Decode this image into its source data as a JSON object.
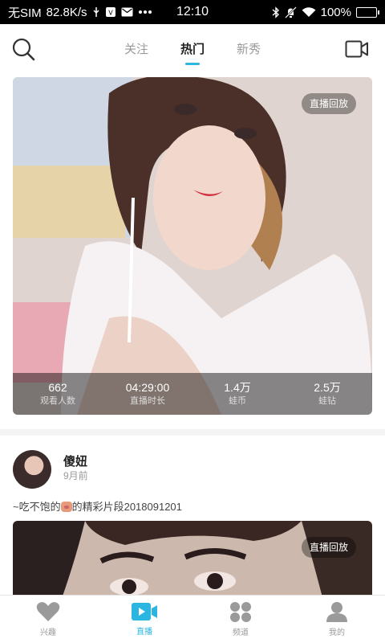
{
  "status_bar": {
    "carrier": "无SIM",
    "speed": "82.8K/s",
    "time": "12:10",
    "battery": "100%"
  },
  "top_nav": {
    "tabs": [
      "关注",
      "热门",
      "新秀"
    ],
    "active_tab": "热门",
    "search_icon": "search-icon",
    "video_icon": "video-camera-icon"
  },
  "card1": {
    "badge": "直播回放",
    "stats": [
      {
        "value": "662",
        "label": "观看人数"
      },
      {
        "value": "04:29:00",
        "label": "直播时长"
      },
      {
        "value": "1.4万",
        "label": "蛙币"
      },
      {
        "value": "2.5万",
        "label": "蛙钻"
      }
    ]
  },
  "post": {
    "username": "傻妞",
    "time": "9月前",
    "text_before": "~吃不饱的",
    "text_after": "的精彩片段2018091201",
    "card_badge": "直播回放"
  },
  "bottom_nav": {
    "items": [
      {
        "label": "兴趣",
        "icon": "heart-icon"
      },
      {
        "label": "直播",
        "icon": "live-video-icon"
      },
      {
        "label": "频道",
        "icon": "grid-dots-icon"
      },
      {
        "label": "我的",
        "icon": "user-icon"
      }
    ],
    "active_index": 1
  },
  "colors": {
    "accent": "#2ab6e0",
    "inactive": "#9a9a9a"
  }
}
